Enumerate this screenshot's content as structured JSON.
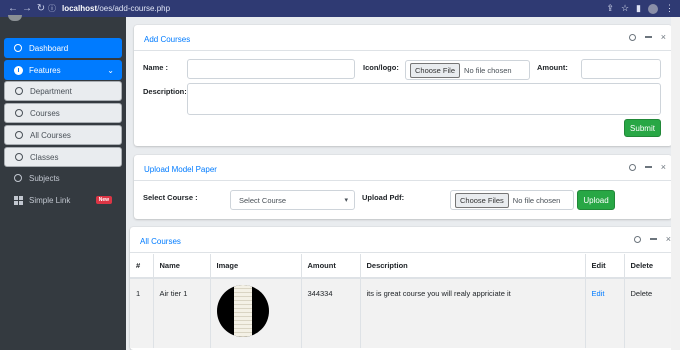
{
  "browser": {
    "url_host": "localhost",
    "url_path": "/oes/add-course.php"
  },
  "sidebar": {
    "items": [
      {
        "label": "Dashboard"
      },
      {
        "label": "Features"
      },
      {
        "label": "Department"
      },
      {
        "label": "Courses"
      },
      {
        "label": "All Courses"
      },
      {
        "label": "Classes"
      },
      {
        "label": "Subjects"
      },
      {
        "label": "Simple Link",
        "badge": "New"
      }
    ]
  },
  "add_course": {
    "title": "Add Courses",
    "name_label": "Name :",
    "name_value": "",
    "icon_label": "Icon/logo:",
    "icon_button": "Choose File",
    "icon_status": "No file chosen",
    "amount_label": "Amount:",
    "amount_value": "",
    "description_label": "Description:",
    "description_value": "",
    "submit_label": "Submit"
  },
  "upload_paper": {
    "title": "Upload Model Paper",
    "select_course_label": "Select Course :",
    "select_course_value": "Select Course",
    "upload_pdf_label": "Upload Pdf:",
    "pdf_button": "Choose Files",
    "pdf_status": "No file chosen",
    "upload_label": "Upload"
  },
  "all_courses": {
    "title": "All Courses",
    "columns": [
      "#",
      "Name",
      "Image",
      "Amount",
      "Description",
      "Edit",
      "Delete"
    ],
    "rows": [
      {
        "num": "1",
        "name": "Air tier 1",
        "amount": "344334",
        "description": "its is great course you will realy appriciate it",
        "edit": "Edit",
        "delete": "Delete"
      }
    ]
  },
  "colors": {
    "primary": "#007bff",
    "success": "#28a745",
    "sidebar": "#343a40",
    "browser_bar": "#2f3a73"
  }
}
